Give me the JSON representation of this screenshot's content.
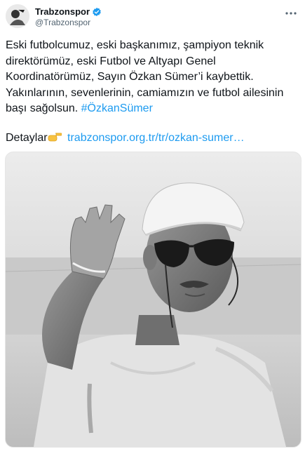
{
  "tweet": {
    "display_name": "Trabzonspor",
    "handle": "@Trabzonspor",
    "lines": [
      "Eski futbolcumuz, eski başkanımız, şampiyon teknik",
      "direktörümüz, eski Futbol ve Altyapı Genel",
      "Koordinatörümüz, Sayın Özkan Sümer’i kaybettik.",
      "Yakınlarının, sevenlerinin, camiamızın ve futbol ailesinin"
    ],
    "last_line_text": "başı sağolsun.",
    "hashtag": "#ÖzkanSümer",
    "details_label": "Detaylar",
    "link_text": "trabzonspor.org.tr/tr/ozkan-sumer…"
  },
  "icons": {
    "avatar": "team-logo-avatar",
    "verified": "verified-badge-icon",
    "more": "more-options-icon",
    "pointing": "pointing-right-hand-emoji"
  },
  "colors": {
    "text": "#0f1419",
    "secondary": "#536471",
    "link": "#1d9bf0"
  }
}
